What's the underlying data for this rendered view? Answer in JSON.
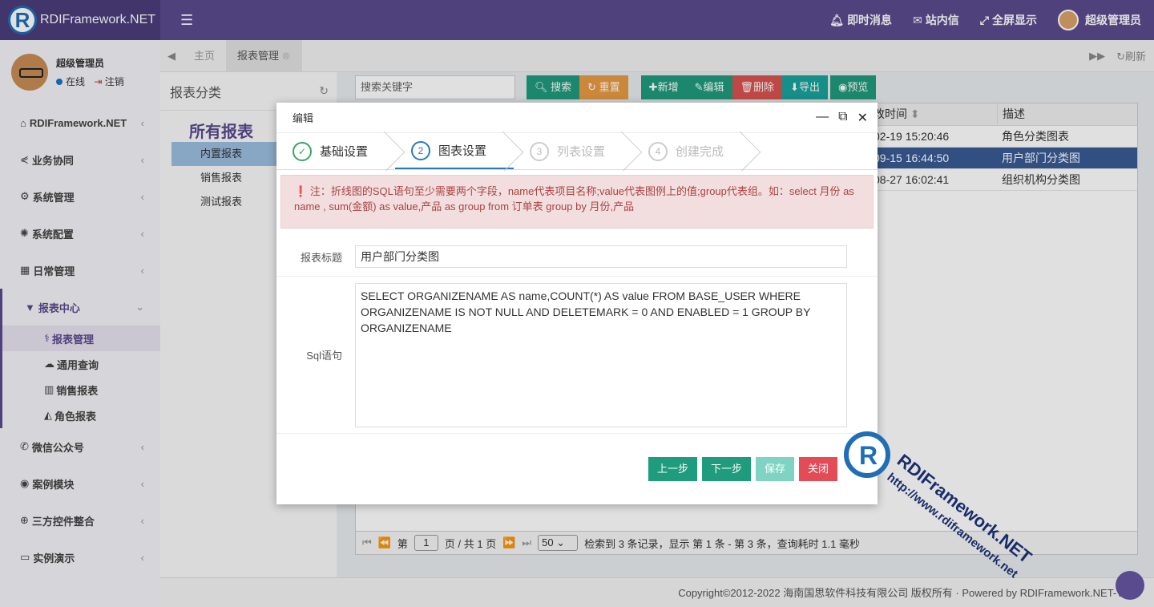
{
  "brand": {
    "name": "RDIFramework.NET",
    "logo_letter": "R"
  },
  "topnav": [
    {
      "icon": "bell-icon",
      "label": "即时消息"
    },
    {
      "icon": "envelope-icon",
      "label": "站内信"
    },
    {
      "icon": "expand-icon",
      "label": "全屏显示"
    },
    {
      "icon": "avatar",
      "label": "超级管理员"
    }
  ],
  "user": {
    "name": "超级管理员",
    "status": "在线",
    "logout": "注销"
  },
  "sidebar": {
    "items": [
      {
        "label": "RDIFramework.NET"
      },
      {
        "label": "业务协同"
      },
      {
        "label": "系统管理"
      },
      {
        "label": "系统配置"
      },
      {
        "label": "日常管理"
      },
      {
        "label": "报表中心"
      },
      {
        "label": "微信公众号"
      },
      {
        "label": "案例模块"
      },
      {
        "label": "三方控件整合"
      },
      {
        "label": "实例演示"
      }
    ],
    "sub_items": [
      {
        "label": "报表管理"
      },
      {
        "label": "通用查询"
      },
      {
        "label": "销售报表"
      },
      {
        "label": "角色报表"
      }
    ]
  },
  "tabs": {
    "home": "主页",
    "active": "报表管理",
    "refresh": "刷新"
  },
  "tree": {
    "title": "报表分类",
    "root": "所有报表",
    "nodes": [
      "内置报表",
      "销售报表",
      "测试报表"
    ]
  },
  "toolbar": {
    "search_placeholder": "搜索关键字",
    "search": "搜索",
    "reset": "重置",
    "add": "新增",
    "edit": "编辑",
    "delete": "删除",
    "export": "导出",
    "preview": "预览"
  },
  "grid": {
    "headers": [
      "改时间",
      "描述"
    ],
    "rows": [
      [
        "02-19 15:20:46",
        "角色分类图表"
      ],
      [
        "09-15 16:44:50",
        "用户部门分类图"
      ],
      [
        "08-27 16:02:41",
        "组织机构分类图"
      ]
    ]
  },
  "pager": {
    "page_prefix": "第",
    "page": "1",
    "page_suffix": "页 / 共 1 页",
    "page_size": "50",
    "summary": "检索到 3 条记录，显示 第 1 条 - 第 3 条，查询耗时 1.1 毫秒"
  },
  "footer": "Copyright©2012-2022 海南国思软件科技有限公司 版权所有 · Powered by RDIFramework.NET-V5.0",
  "dialog": {
    "title": "编辑",
    "steps": [
      {
        "num": "✓",
        "label": "基础设置"
      },
      {
        "num": "2",
        "label": "图表设置"
      },
      {
        "num": "3",
        "label": "列表设置"
      },
      {
        "num": "4",
        "label": "创建完成"
      }
    ],
    "alert": "注：折线图的SQL语句至少需要两个字段，name代表项目名称;value代表图例上的值;group代表组。如：select 月份 as name , sum(金额) as value,产品 as group from 订单表 group by 月份,产品",
    "title_label": "报表标题",
    "title_value": "用户部门分类图",
    "sql_label": "Sql语句",
    "sql_value": "SELECT ORGANIZENAME AS name,COUNT(*) AS value FROM BASE_USER WHERE ORGANIZENAME IS NOT NULL AND DELETEMARK = 0 AND ENABLED = 1 GROUP BY ORGANIZENAME",
    "buttons": {
      "prev": "上一步",
      "next": "下一步",
      "save": "保存",
      "close": "关闭"
    }
  },
  "watermark": {
    "title": "RDIFramework.NET",
    "url": "http://www.rdiframework.net"
  }
}
